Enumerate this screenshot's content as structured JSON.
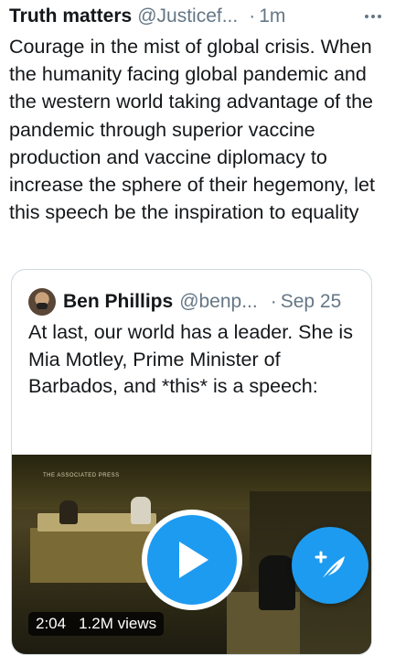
{
  "tweet": {
    "author_name": "Truth matters",
    "author_handle": "@Justicef...",
    "separator": "·",
    "time": "1m",
    "text": "Courage in the mist of global crisis. When the humanity facing global pandemic and the western world taking advantage of the pandemic through superior vaccine production and vaccine diplomacy to increase the sphere of their hegemony, let this speech be the inspiration to equality"
  },
  "quote": {
    "author_name": "Ben Phillips",
    "author_handle": "@benp...",
    "separator": "·",
    "date": "Sep 25",
    "text": "At last, our world has a leader. She is Mia Motley, Prime Minister of Barbados, and *this* is a speech:",
    "video": {
      "watermark": "THE ASSOCIATED PRESS",
      "duration": "2:04",
      "views": "1.2M views"
    }
  },
  "icons": {
    "more": "more-horizontal-icon",
    "play": "play-icon",
    "compose": "compose-tweet-icon"
  },
  "colors": {
    "accent": "#1d9bf0",
    "secondary_text": "#657786",
    "primary_text": "#14171a",
    "card_border": "#cfd9de"
  }
}
